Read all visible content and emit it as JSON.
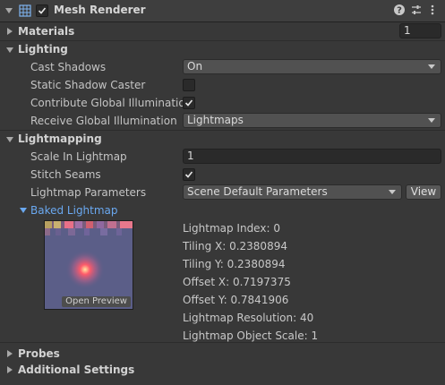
{
  "component": {
    "title": "Mesh Renderer",
    "enabled": true,
    "icons": [
      "mesh-renderer-icon",
      "help-icon",
      "presets-icon",
      "kebab-menu-icon"
    ]
  },
  "materials": {
    "label": "Materials",
    "count": "1"
  },
  "lighting": {
    "label": "Lighting",
    "cast_shadows": {
      "label": "Cast Shadows",
      "value": "On"
    },
    "static_shadow_caster": {
      "label": "Static Shadow Caster",
      "checked": false
    },
    "contribute_gi": {
      "label": "Contribute Global Illumination",
      "checked": true
    },
    "receive_gi": {
      "label": "Receive Global Illumination",
      "value": "Lightmaps"
    }
  },
  "lightmapping": {
    "label": "Lightmapping",
    "scale_in_lightmap": {
      "label": "Scale In Lightmap",
      "value": "1"
    },
    "stitch_seams": {
      "label": "Stitch Seams",
      "checked": true
    },
    "lightmap_parameters": {
      "label": "Lightmap Parameters",
      "value": "Scene Default Parameters",
      "view_button": "View"
    },
    "baked_lightmap": {
      "label": "Baked Lightmap",
      "open_preview": "Open Preview",
      "info": [
        "Lightmap Index: 0",
        "Tiling X: 0.2380894",
        "Tiling Y: 0.2380894",
        "Offset X: 0.7197375",
        "Offset Y: 0.7841906",
        "Lightmap Resolution: 40",
        "Lightmap Object Scale: 1"
      ]
    }
  },
  "probes": {
    "label": "Probes"
  },
  "additional_settings": {
    "label": "Additional Settings"
  },
  "colors": {
    "background": "#383838",
    "header": "#3e3e3e",
    "link_blue": "#6aa8f0",
    "field_dark": "#2a2a2a"
  }
}
